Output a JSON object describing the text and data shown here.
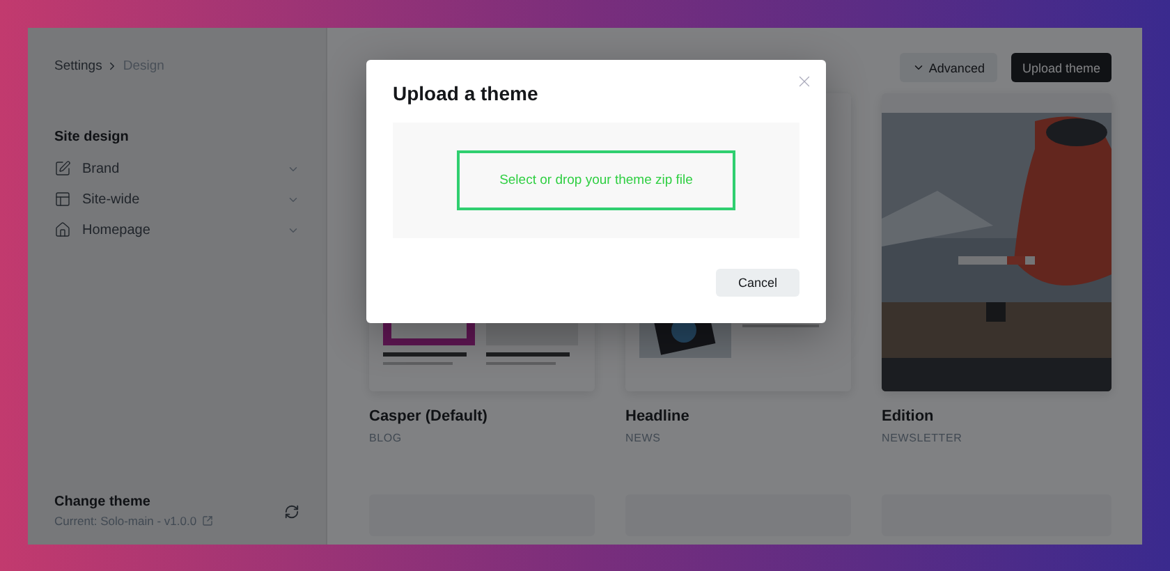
{
  "breadcrumb": [
    {
      "label": "Settings",
      "selected": false
    },
    {
      "label": "Design",
      "selected": true
    }
  ],
  "sidebar": {
    "title": "Site design",
    "items": [
      {
        "label": "Brand"
      },
      {
        "label": "Site-wide"
      },
      {
        "label": "Homepage"
      }
    ]
  },
  "change_theme": {
    "title": "Change theme",
    "current": "Current: Solo-main - v1.0.0"
  },
  "toolbar": {
    "advanced": "Advanced",
    "upload": "Upload theme"
  },
  "themes": [
    {
      "name": "Casper (Default)",
      "category": "BLOG"
    },
    {
      "name": "Headline",
      "category": "NEWS"
    },
    {
      "name": "Edition",
      "category": "NEWSLETTER"
    }
  ],
  "modal": {
    "title": "Upload a theme",
    "dropzone": "Select or drop your theme zip file",
    "cancel": "Cancel"
  }
}
